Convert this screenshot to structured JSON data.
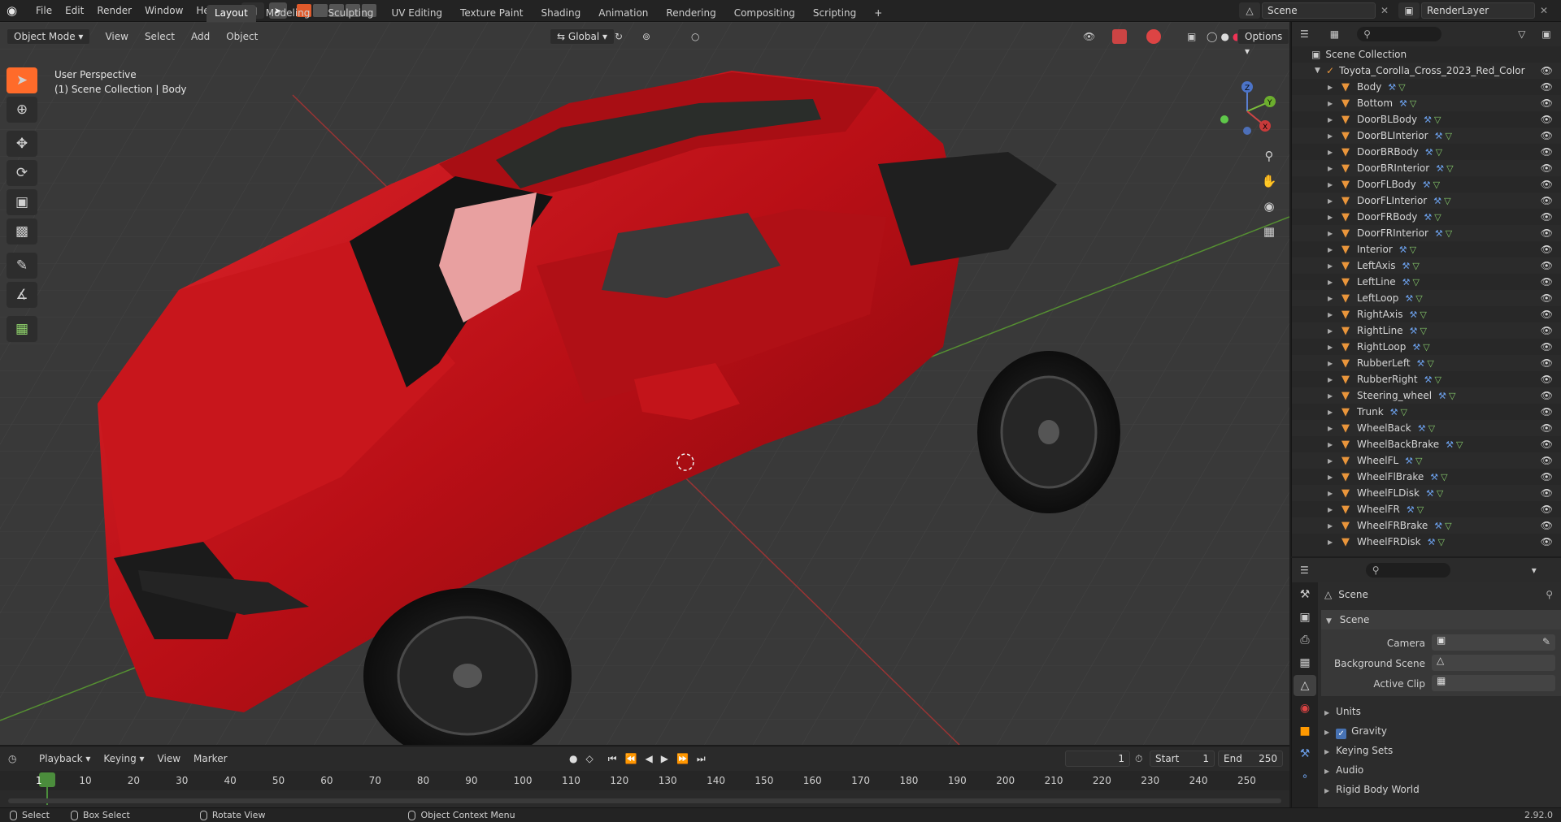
{
  "topbar": {
    "menus": [
      "File",
      "Edit",
      "Render",
      "Window",
      "Help"
    ],
    "workspaces": [
      "Layout",
      "Modeling",
      "Sculpting",
      "UV Editing",
      "Texture Paint",
      "Shading",
      "Animation",
      "Rendering",
      "Compositing",
      "Scripting"
    ],
    "active_workspace": "Layout",
    "add_tab": "+",
    "scene_name": "Scene",
    "view_layer": "RenderLayer"
  },
  "viewport": {
    "mode": "Object Mode",
    "menus": [
      "View",
      "Select",
      "Add",
      "Object"
    ],
    "orientation": "Global",
    "options_label": "Options",
    "perspective_label": "User Perspective",
    "context_label": "(1) Scene Collection | Body",
    "body_color": "#c0141a",
    "grid_bg": "#393939",
    "axis_x_color": "#b03a3a",
    "axis_y_color": "#5e9b35",
    "gizmo": {
      "x": "X",
      "y": "Y",
      "z": "Z"
    }
  },
  "outliner": {
    "root": "Scene Collection",
    "collection": "Toyota_Corolla_Cross_2023_Red_Color",
    "objects": [
      "Body",
      "Bottom",
      "DoorBLBody",
      "DoorBLInterior",
      "DoorBRBody",
      "DoorBRInterior",
      "DoorFLBody",
      "DoorFLInterior",
      "DoorFRBody",
      "DoorFRInterior",
      "Interior",
      "LeftAxis",
      "LeftLine",
      "LeftLoop",
      "RightAxis",
      "RightLine",
      "RightLoop",
      "RubberLeft",
      "RubberRight",
      "Steering_wheel",
      "Trunk",
      "WheelBack",
      "WheelBackBrake",
      "WheelFL",
      "WheelFlBrake",
      "WheelFLDisk",
      "WheelFR",
      "WheelFRBrake",
      "WheelFRDisk"
    ]
  },
  "properties": {
    "header": "Scene",
    "panel_title": "Scene",
    "camera_label": "Camera",
    "background_scene_label": "Background Scene",
    "active_clip_label": "Active Clip",
    "subpanels": [
      "Units",
      "Gravity",
      "Keying Sets",
      "Audio",
      "Rigid Body World"
    ],
    "gravity_checked": true
  },
  "timeline": {
    "menus": [
      "Playback",
      "Keying",
      "View",
      "Marker"
    ],
    "current_frame": "1",
    "start_label": "Start",
    "start_value": "1",
    "end_label": "End",
    "end_value": "250",
    "ticks": [
      "1",
      "10",
      "20",
      "30",
      "40",
      "50",
      "60",
      "70",
      "80",
      "90",
      "100",
      "110",
      "120",
      "130",
      "140",
      "150",
      "160",
      "170",
      "180",
      "190",
      "200",
      "210",
      "220",
      "230",
      "240",
      "250"
    ]
  },
  "statusbar": {
    "select": "Select",
    "box_select": "Box Select",
    "rotate_view": "Rotate View",
    "context_menu": "Object Context Menu",
    "version": "2.92.0"
  }
}
